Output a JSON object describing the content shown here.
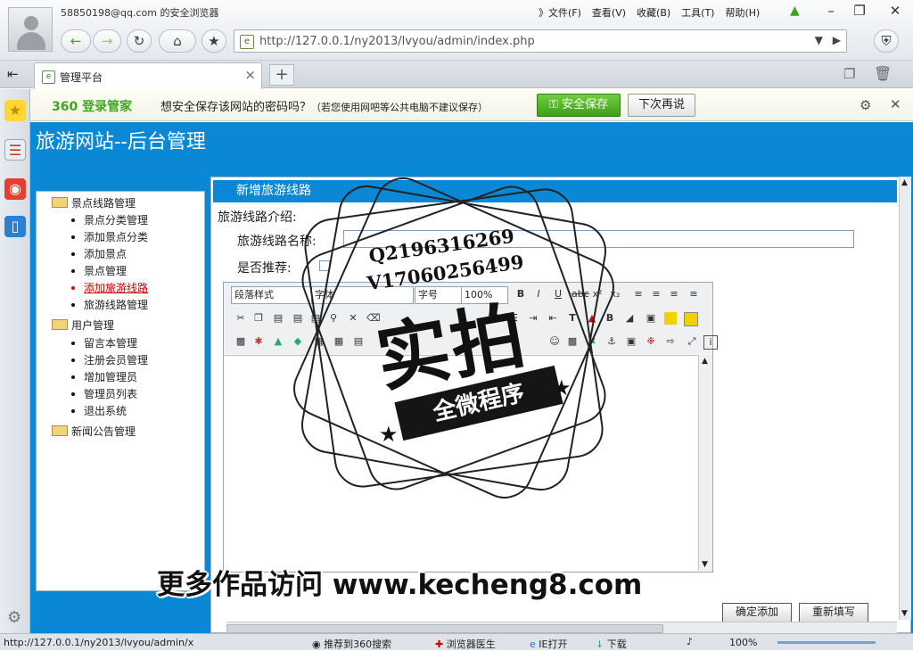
{
  "browser": {
    "account": "58850198@qq.com 的安全浏览器",
    "menus": [
      "》文件(F)",
      "查看(V)",
      "收藏(B)",
      "工具(T)",
      "帮助(H)"
    ],
    "url": "http://127.0.0.1/ny2013/lvyou/admin/index.php",
    "tab_title": "管理平台",
    "ie_label": "e"
  },
  "password_bar": {
    "logo": "360 登录管家",
    "message": "想安全保存该网站的密码吗？",
    "note": "（若您使用网吧等公共电脑不建议保存）",
    "save_label": "安全保存",
    "later_label": "下次再说"
  },
  "site": {
    "title": "旅游网站--后台管理"
  },
  "nav": {
    "groups": [
      {
        "label": "景点线路管理",
        "items": [
          "景点分类管理",
          "添加景点分类",
          "添加景点",
          "景点管理",
          "添加旅游线路",
          "旅游线路管理"
        ]
      },
      {
        "label": "用户管理",
        "items": [
          "留言本管理",
          "注册会员管理",
          "增加管理员",
          "管理员列表",
          "退出系统"
        ]
      },
      {
        "label": "新闻公告管理",
        "items": []
      }
    ]
  },
  "form": {
    "panel_title": "新增旅游线路",
    "intro_label": "旅游线路介绍:",
    "name_label": "旅游线路名称:",
    "recommend_label": "是否推荐:",
    "editor": {
      "paragraph_style": "段落样式",
      "font": "字体",
      "size": "字号",
      "zoom": "100%"
    },
    "submit_label": "确定添加",
    "reset_label": "重新填写"
  },
  "status": {
    "url": "http://127.0.0.1/ny2013/lvyou/admin/x",
    "items": [
      "推荐到360搜索",
      "浏览器医生",
      "IE打开",
      "下载"
    ],
    "zoom": "100%"
  },
  "watermark": {
    "qq": "Q2196316269",
    "wechat": "V17060256499",
    "big": "实拍",
    "ribbon": "全微程序",
    "banner": "更多作品访问 www.kecheng8.com"
  }
}
